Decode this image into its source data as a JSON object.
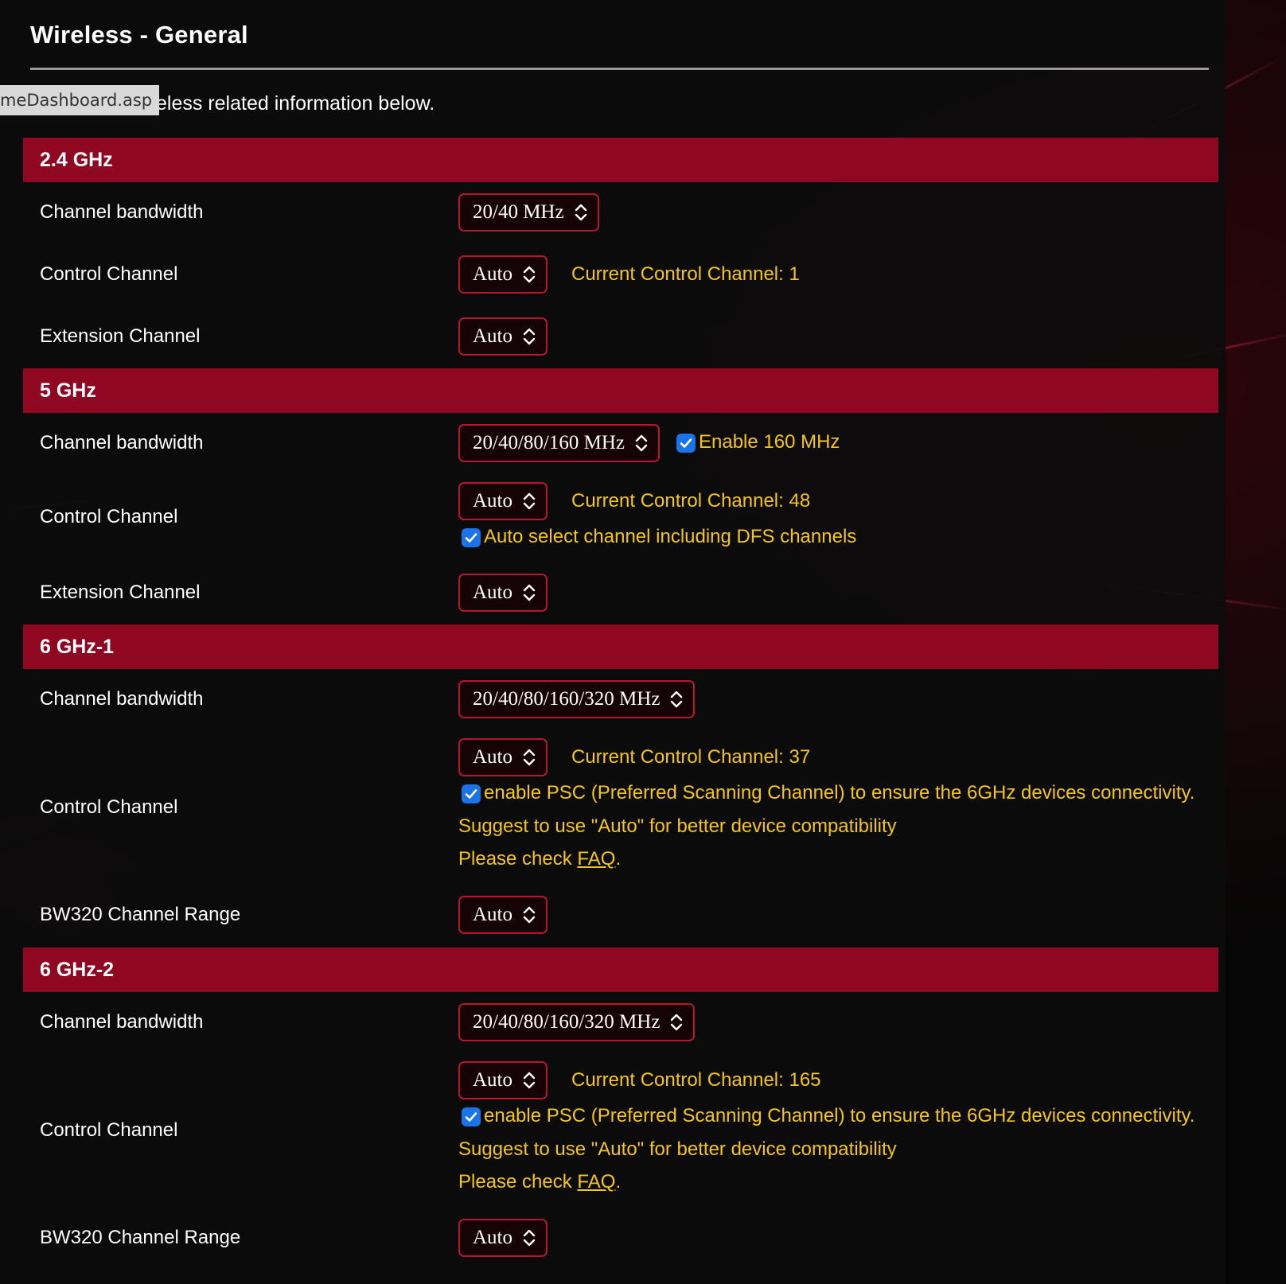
{
  "page": {
    "title": "Wireless - General",
    "intro_visible": "eless related information below.",
    "url_tooltip": "meDashboard.asp"
  },
  "bands": [
    {
      "name": "2.4 GHz",
      "bandwidth": {
        "label": "Channel bandwidth",
        "value": "20/40 MHz"
      },
      "control": {
        "label": "Control Channel",
        "value": "Auto",
        "current": "Current Control Channel: 1"
      },
      "extension": {
        "label": "Extension Channel",
        "value": "Auto"
      }
    },
    {
      "name": "5 GHz",
      "bandwidth": {
        "label": "Channel bandwidth",
        "value": "20/40/80/160 MHz",
        "checkbox_label": "Enable 160 MHz",
        "checked": true
      },
      "control": {
        "label": "Control Channel",
        "value": "Auto",
        "current": "Current Control Channel: 48",
        "dfs_label": "Auto select channel including DFS channels",
        "dfs_checked": true
      },
      "extension": {
        "label": "Extension Channel",
        "value": "Auto"
      }
    },
    {
      "name": "6 GHz-1",
      "bandwidth": {
        "label": "Channel bandwidth",
        "value": "20/40/80/160/320 MHz"
      },
      "control": {
        "label": "Control Channel",
        "value": "Auto",
        "current": "Current Control Channel: 37",
        "psc_label": "enable PSC (Preferred Scanning Channel) to ensure the 6GHz devices connectivity.",
        "psc_checked": true,
        "suggest": "Suggest to use \"Auto\" for better device compatibility",
        "check_prefix": "Please check ",
        "faq_link": "FAQ",
        "check_suffix": "."
      },
      "bw320": {
        "label": "BW320 Channel Range",
        "value": "Auto"
      }
    },
    {
      "name": "6 GHz-2",
      "bandwidth": {
        "label": "Channel bandwidth",
        "value": "20/40/80/160/320 MHz"
      },
      "control": {
        "label": "Control Channel",
        "value": "Auto",
        "current": "Current Control Channel: 165",
        "psc_label": "enable PSC (Preferred Scanning Channel) to ensure the 6GHz devices connectivity.",
        "psc_checked": true,
        "suggest": "Suggest to use \"Auto\" for better device compatibility",
        "check_prefix": "Please check ",
        "faq_link": "FAQ",
        "check_suffix": "."
      },
      "bw320": {
        "label": "BW320 Channel Range",
        "value": "Auto"
      }
    }
  ],
  "colors": {
    "section_header": "#8f0720",
    "select_border": "#b8152e",
    "info_text": "#f5c518",
    "checkbox": "#1a73e8"
  },
  "icons": {
    "select_arrows": "up-down-chevron-icon",
    "checkbox": "checkmark-icon"
  }
}
